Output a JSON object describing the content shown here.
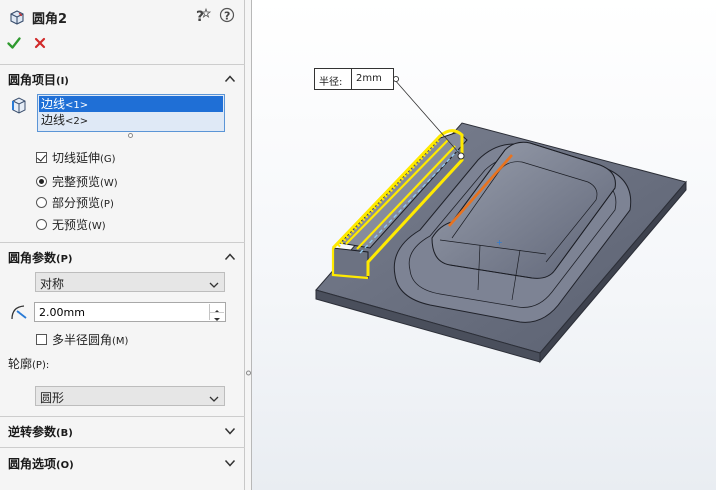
{
  "feature": {
    "title": "圆角2",
    "icon": "fillet-feature-icon"
  },
  "toolbar": {
    "ok": "confirm-check-icon",
    "cancel": "cancel-x-icon"
  },
  "items_section": {
    "title": "圆角项目",
    "key": "(I)",
    "items": [
      {
        "label": "边线",
        "ref": "<1>",
        "selected": true
      },
      {
        "label": "边线",
        "ref": "<2>",
        "selected": false
      }
    ],
    "tangent": {
      "label": "切线延伸",
      "key": "(G)",
      "checked": true
    },
    "preview_options": [
      {
        "label": "完整预览",
        "key": "(W)",
        "selected": true
      },
      {
        "label": "部分预览",
        "key": "(P)",
        "selected": false
      },
      {
        "label": "无预览",
        "key": "(W)",
        "selected": false
      }
    ]
  },
  "params_section": {
    "title": "圆角参数",
    "key": "(P)",
    "type_value": "对称",
    "radius_value": "2.00mm",
    "multi_radius": {
      "label": "多半径圆角",
      "key": "(M)",
      "checked": false
    },
    "profile_label": "轮廓",
    "profile_key": "(P):",
    "profile_value": "圆形"
  },
  "setback_section": {
    "title": "逆转参数",
    "key": "(B)"
  },
  "options_section": {
    "title": "圆角选项",
    "key": "(O)"
  },
  "callout": {
    "label": "半径:",
    "value": "2mm"
  },
  "colors": {
    "selection": "#1f6fd6",
    "highlight_yellow": "#ffea00",
    "edge_orange": "#e8731f",
    "part_body": "#7c8294"
  }
}
